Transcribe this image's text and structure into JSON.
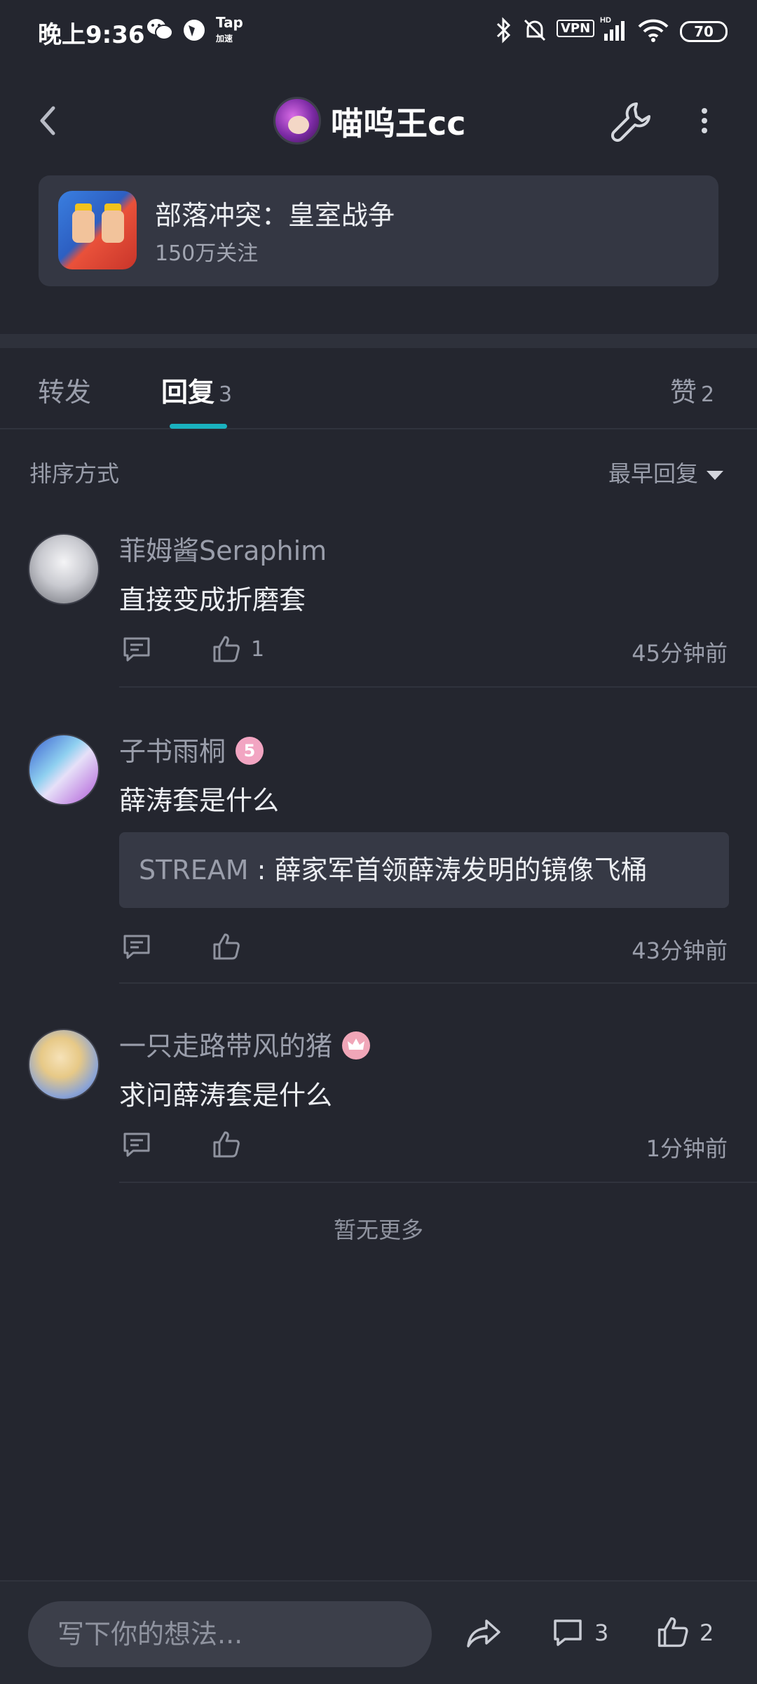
{
  "status_bar": {
    "time": "晚上9:36",
    "tap_label": "Tap",
    "tap_sub": "加速",
    "vpn": "VPN",
    "hd": "HD",
    "battery": "70"
  },
  "header": {
    "title": "喵呜王cc"
  },
  "game_card": {
    "name": "部落冲突：皇室战争",
    "followers": "150万关注"
  },
  "tabs": [
    {
      "label": "转发",
      "count": ""
    },
    {
      "label": "回复",
      "count": "3"
    },
    {
      "label": "赞",
      "count": "2"
    }
  ],
  "sort": {
    "label": "排序方式",
    "value": "最早回复"
  },
  "comments": [
    {
      "name": "菲姆酱Seraphim",
      "text": "直接变成折磨套",
      "likes": "1",
      "time": "45分钟前"
    },
    {
      "name": "子书雨桐",
      "badge": "5",
      "text": "薛涛套是什么",
      "quote_name": "STREAM",
      "quote_sep": " : ",
      "quote_text": "薛家军首领薛涛发明的镜像飞桶",
      "likes": "",
      "time": "43分钟前"
    },
    {
      "name": "一只走路带风的猪",
      "text": "求问薛涛套是什么",
      "likes": "",
      "time": "1分钟前"
    }
  ],
  "no_more": "暂无更多",
  "bottom_bar": {
    "input_placeholder": "写下你的想法...",
    "reply_count": "3",
    "like_count": "2"
  },
  "colors": {
    "background": "#24262f",
    "accent": "#1ab2bf",
    "card": "#343743"
  }
}
